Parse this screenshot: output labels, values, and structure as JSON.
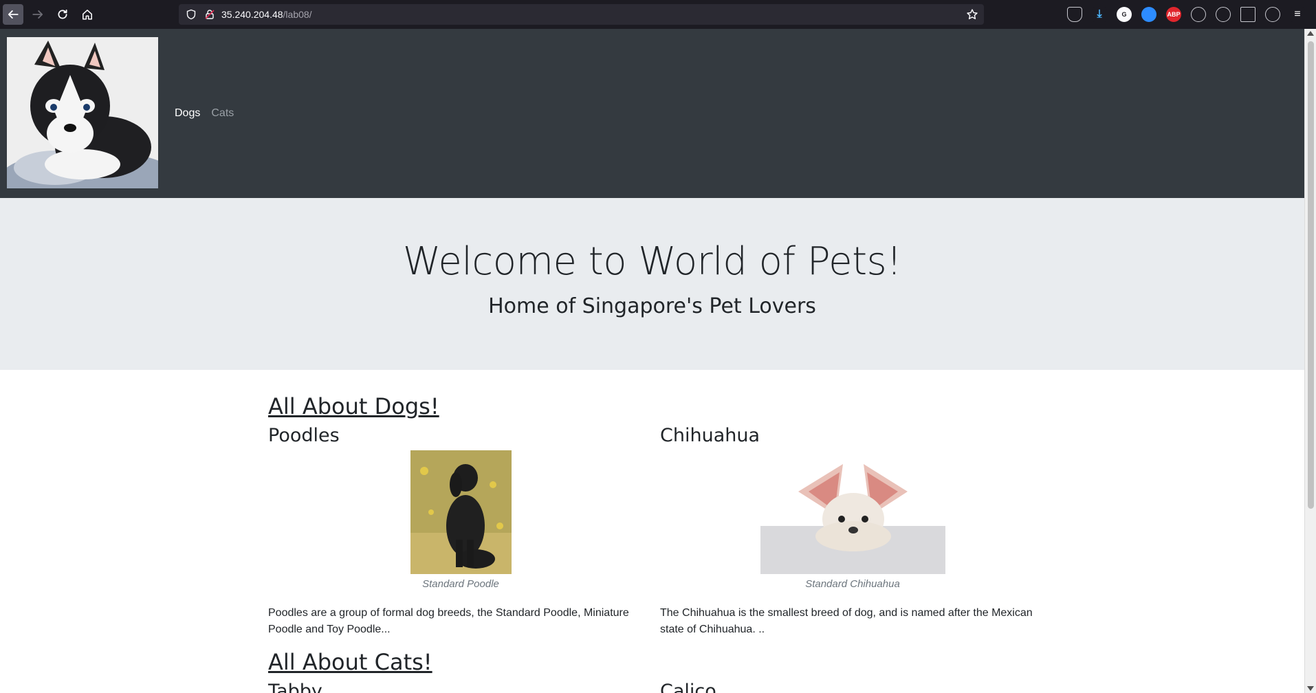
{
  "browser": {
    "url_host": "35.240.204.48",
    "url_path": "/lab08/",
    "extensions": [
      {
        "name": "pocket-icon",
        "label": "",
        "color": "#1c1b22"
      },
      {
        "name": "download-icon",
        "label": "",
        "color": "#1c1b22"
      },
      {
        "name": "grammarly-icon",
        "label": "G",
        "color": "#1c1b22"
      },
      {
        "name": "zoom-icon",
        "label": "",
        "color": "#2d8cff"
      },
      {
        "name": "adblock-icon",
        "label": "ABP",
        "color": "#e0262d"
      },
      {
        "name": "extension-icon-1",
        "label": "",
        "color": "#1c1b22"
      },
      {
        "name": "extension-icon-2",
        "label": "",
        "color": "#1c1b22"
      },
      {
        "name": "grid-icon",
        "label": "",
        "color": "#1c1b22"
      },
      {
        "name": "extension-icon-3",
        "label": "",
        "color": "#1c1b22"
      },
      {
        "name": "menu-icon",
        "label": "",
        "color": "#1c1b22"
      }
    ]
  },
  "nav": {
    "links": [
      "Dogs",
      "Cats"
    ]
  },
  "hero": {
    "title": "Welcome to World of Pets!",
    "subtitle": "Home of Singapore's Pet Lovers"
  },
  "dogs": {
    "section_title": "All About Dogs!",
    "items": [
      {
        "title": "Poodles",
        "caption": "Standard Poodle",
        "description": "Poodles are a group of formal dog breeds, the Standard Poodle, Miniature Poodle and Toy Poodle..."
      },
      {
        "title": "Chihuahua",
        "caption": "Standard Chihuahua",
        "description": "The Chihuahua is the smallest breed of dog, and is named after the Mexican state of Chihuahua. .."
      }
    ]
  },
  "cats": {
    "section_title": "All About Cats!",
    "items": [
      {
        "title": "Tabby"
      },
      {
        "title": "Calico"
      }
    ]
  }
}
